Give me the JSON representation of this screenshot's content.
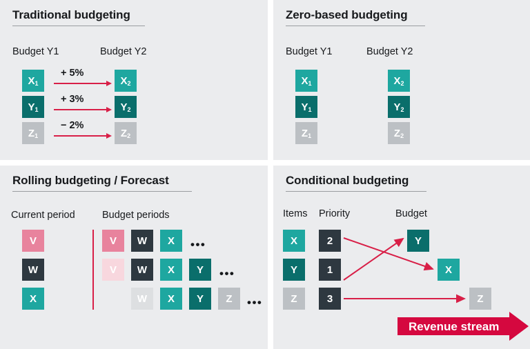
{
  "theme": {
    "page_bg": "#ffffff",
    "panel_bg": "#ebecee",
    "teal": "#1ea7a0",
    "dark_teal": "#0a6e6b",
    "grey": "#bcc0c4",
    "light_grey": "#dddfe1",
    "pink": "#e8839d",
    "light_pink": "#f8d7de",
    "charcoal": "#2e3840",
    "red": "#d81f47",
    "crimson": "#d5083f",
    "text": "#17191c"
  },
  "panels": {
    "traditional": {
      "title": "Traditional budgeting",
      "columns": [
        {
          "label": "Budget Y1"
        },
        {
          "label": "Budget Y2"
        }
      ],
      "rows": [
        {
          "from": "X",
          "from_sub": "1",
          "to": "X",
          "to_sub": "2",
          "change": "+ 5%",
          "color": "teal"
        },
        {
          "from": "Y",
          "from_sub": "1",
          "to": "Y",
          "to_sub": "2",
          "change": "+ 3%",
          "color": "dark_teal"
        },
        {
          "from": "Z",
          "from_sub": "1",
          "to": "Z",
          "to_sub": "2",
          "change": "− 2%",
          "color": "grey"
        }
      ]
    },
    "zero_based": {
      "title": "Zero-based budgeting",
      "columns": [
        {
          "label": "Budget Y1"
        },
        {
          "label": "Budget Y2"
        }
      ],
      "rows": [
        {
          "from": "X",
          "from_sub": "1",
          "to": "X",
          "to_sub": "2",
          "color": "teal"
        },
        {
          "from": "Y",
          "from_sub": "1",
          "to": "Y",
          "to_sub": "2",
          "color": "dark_teal"
        },
        {
          "from": "Z",
          "from_sub": "1",
          "to": "Z",
          "to_sub": "2",
          "color": "grey"
        }
      ]
    },
    "rolling": {
      "title": "Rolling budgeting / Forecast",
      "columns": [
        {
          "label": "Current period"
        },
        {
          "label": "Budget periods"
        }
      ],
      "current_period": [
        {
          "label": "V",
          "color": "pink"
        },
        {
          "label": "W",
          "color": "charcoal"
        },
        {
          "label": "X",
          "color": "teal"
        }
      ],
      "budget_periods": [
        {
          "cells": [
            {
              "label": "V",
              "color": "pink"
            },
            {
              "label": "W",
              "color": "charcoal"
            },
            {
              "label": "X",
              "color": "teal"
            }
          ],
          "ellipsis": "•••"
        },
        {
          "cells": [
            {
              "label": "V",
              "color": "light_pink"
            },
            {
              "label": "W",
              "color": "charcoal"
            },
            {
              "label": "X",
              "color": "teal"
            },
            {
              "label": "Y",
              "color": "dark_teal"
            }
          ],
          "ellipsis": "•••"
        },
        {
          "cells": [
            {
              "label": "W",
              "color": "light_grey"
            },
            {
              "label": "X",
              "color": "teal"
            },
            {
              "label": "Y",
              "color": "dark_teal"
            },
            {
              "label": "Z",
              "color": "grey"
            }
          ],
          "ellipsis": "•••"
        }
      ]
    },
    "conditional": {
      "title": "Conditional budgeting",
      "columns": [
        {
          "label": "Items"
        },
        {
          "label": "Priority"
        },
        {
          "label": "Budget"
        }
      ],
      "items": [
        {
          "label": "X",
          "color": "teal",
          "priority": "2"
        },
        {
          "label": "Y",
          "color": "dark_teal",
          "priority": "1"
        },
        {
          "label": "Z",
          "color": "grey",
          "priority": "3"
        }
      ],
      "budget": [
        {
          "label": "Y",
          "color": "dark_teal"
        },
        {
          "label": "X",
          "color": "teal"
        },
        {
          "label": "Z",
          "color": "grey"
        }
      ],
      "banner": {
        "label": "Revenue stream"
      }
    }
  }
}
